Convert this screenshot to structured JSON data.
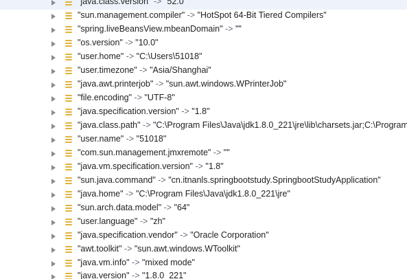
{
  "separator": " -> ",
  "entries": [
    {
      "key": "\"java.class.version\"",
      "value": "\"52.0\""
    },
    {
      "key": "\"sun.management.compiler\"",
      "value": "\"HotSpot 64-Bit Tiered Compilers\""
    },
    {
      "key": "\"spring.liveBeansView.mbeanDomain\"",
      "value": "\"\""
    },
    {
      "key": "\"os.version\"",
      "value": "\"10.0\""
    },
    {
      "key": "\"user.home\"",
      "value": "\"C:\\Users\\51018\""
    },
    {
      "key": "\"user.timezone\"",
      "value": "\"Asia/Shanghai\""
    },
    {
      "key": "\"java.awt.printerjob\"",
      "value": "\"sun.awt.windows.WPrinterJob\""
    },
    {
      "key": "\"file.encoding\"",
      "value": "\"UTF-8\""
    },
    {
      "key": "\"java.specification.version\"",
      "value": "\"1.8\""
    },
    {
      "key": "\"java.class.path\"",
      "value": "\"C:\\Program Files\\Java\\jdk1.8.0_221\\jre\\lib\\charsets.jar;C:\\Program"
    },
    {
      "key": "\"user.name\"",
      "value": "\"51018\""
    },
    {
      "key": "\"com.sun.management.jmxremote\"",
      "value": "\"\""
    },
    {
      "key": "\"java.vm.specification.version\"",
      "value": "\"1.8\""
    },
    {
      "key": "\"sun.java.command\"",
      "value": "\"cn.itnanls.springbootstudy.SpringbootStudyApplication\""
    },
    {
      "key": "\"java.home\"",
      "value": "\"C:\\Program Files\\Java\\jdk1.8.0_221\\jre\""
    },
    {
      "key": "\"sun.arch.data.model\"",
      "value": "\"64\""
    },
    {
      "key": "\"user.language\"",
      "value": "\"zh\""
    },
    {
      "key": "\"java.specification.vendor\"",
      "value": "\"Oracle Corporation\""
    },
    {
      "key": "\"awt.toolkit\"",
      "value": "\"sun.awt.windows.WToolkit\""
    },
    {
      "key": "\"java.vm.info\"",
      "value": "\"mixed mode\""
    },
    {
      "key": "\"java.version\"",
      "value": "\"1.8.0_221\""
    }
  ]
}
